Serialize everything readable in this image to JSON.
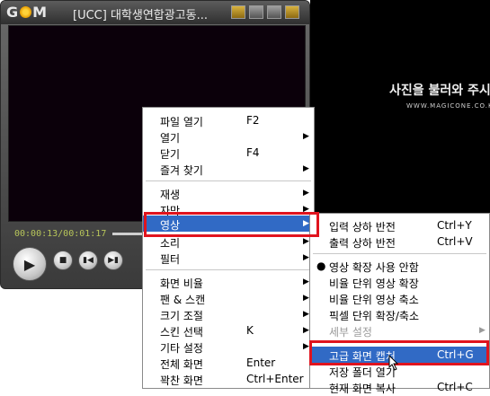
{
  "player": {
    "logo": "G●M",
    "title": "[UCC] 대학생연합광고동...",
    "time": "00:00:13/00:01:17",
    "icons": {
      "fullscreen": "fullscreen-icon",
      "minimize": "minimize-icon",
      "maximize": "maximize-icon",
      "close": "close-icon",
      "play": "play-icon",
      "stop": "stop-icon",
      "prev": "prev-icon",
      "next": "next-icon"
    }
  },
  "right_pane": {
    "caption": "사진을 불러와 주시",
    "url": "WWW.MAGICONE.CO.K"
  },
  "context_menu": {
    "items": [
      {
        "label": "파일 열기",
        "shortcut": "F2"
      },
      {
        "label": "열기",
        "submenu": true
      },
      {
        "label": "닫기",
        "shortcut": "F4"
      },
      {
        "label": "즐겨 찾기",
        "submenu": true
      },
      {
        "label": "재생",
        "submenu": true
      },
      {
        "label": "자막",
        "submenu": true
      },
      {
        "label": "영상",
        "submenu": true,
        "highlighted": true
      },
      {
        "label": "소리",
        "submenu": true
      },
      {
        "label": "필터",
        "submenu": true
      },
      {
        "label": "화면 비율",
        "submenu": true
      },
      {
        "label": "팬 & 스캔",
        "submenu": true
      },
      {
        "label": "크기 조절",
        "submenu": true
      },
      {
        "label": "스킨 선택",
        "shortcut": "K",
        "submenu": true
      },
      {
        "label": "기타 설정",
        "submenu": true
      },
      {
        "label": "전체 화면",
        "shortcut": "Enter"
      },
      {
        "label": "꽉찬 화면",
        "shortcut": "Ctrl+Enter"
      }
    ]
  },
  "video_submenu": {
    "items": [
      {
        "label": "입력 상하 반전",
        "shortcut": "Ctrl+Y"
      },
      {
        "label": "출력 상하 반전",
        "shortcut": "Ctrl+V"
      },
      {
        "label": "영상 확장 사용 안함",
        "bullet": true
      },
      {
        "label": "비율 단위 영상 확장"
      },
      {
        "label": "비율 단위 영상 축소"
      },
      {
        "label": "픽셀 단위 확장/축소"
      },
      {
        "label": "세부 설정",
        "disabled": true,
        "submenu": true
      },
      {
        "label": "고급 화면 캡처",
        "shortcut": "Ctrl+G",
        "highlighted": true
      },
      {
        "label": "저장 폴더 열기"
      },
      {
        "label": "현재 화면 복사",
        "shortcut": "Ctrl+C"
      }
    ]
  },
  "colors": {
    "highlight": "#316ac5",
    "annotation": "#e0141e"
  }
}
